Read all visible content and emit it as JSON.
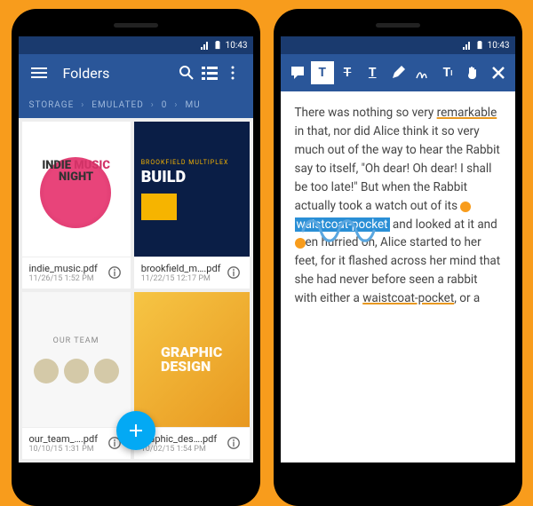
{
  "status": {
    "time": "10:43"
  },
  "left": {
    "title": "Folders",
    "breadcrumb": [
      "STORAGE",
      "EMULATED",
      "0",
      "MU"
    ],
    "files": [
      {
        "name": "indie_music.pdf",
        "date": "11/26/15 1:52 PM",
        "thumb_label1": "INDIE",
        "thumb_label2": "MUSIC",
        "thumb_label3": "NIGHT"
      },
      {
        "name": "brookfield_m….pdf",
        "date": "11/22/15 12:17 PM",
        "thumb_brook": "BROOKFIELD MULTIPLEX",
        "thumb_build": "BUILD"
      },
      {
        "name": "our_team_….pdf",
        "date": "10/10/15 1:31 PM",
        "thumb_title": "OUR TEAM"
      },
      {
        "name": "graphic_des….pdf",
        "date": "10/02/15 1:54 PM",
        "thumb_g1": "GRAPHIC",
        "thumb_g2": "DESIGN"
      }
    ]
  },
  "right": {
    "text_before": "There was nothing so very ",
    "remarkable": "remarkable",
    "text_mid1": " in that, nor did Alice think it so very much out of the way to hear the Rabbit say to itself, \"Oh dear! Oh dear! I shall be too late!\" But when the Rabbit actually took a watch out of its ",
    "highlight": "waistcoat-pocket",
    "text_mid2": " and looked at it and ",
    "text_mid3": "en hurried on, Alice started to her feet, for it flashed across her mind that she had never before seen a rabbit with either a ",
    "waist2": "waistcoat-pocket",
    "text_end": ", or a"
  }
}
